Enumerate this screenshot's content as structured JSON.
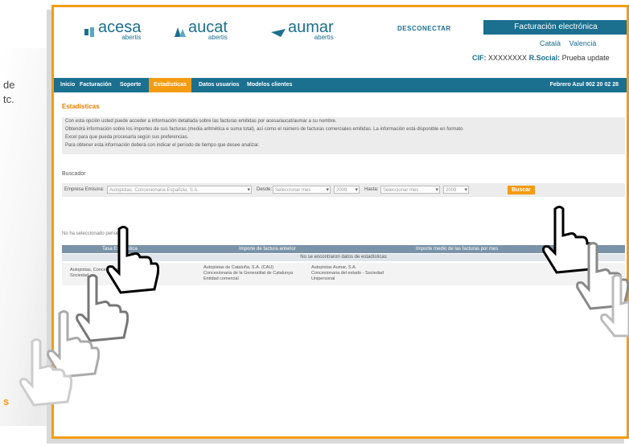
{
  "side_text": [
    "de",
    "tc."
  ],
  "side_orange": "s",
  "header": {
    "logos": [
      {
        "name": "acesa",
        "sub": "abertis"
      },
      {
        "name": "aucat",
        "sub": "abertis"
      },
      {
        "name": "aumar",
        "sub": "abertis"
      }
    ],
    "desconectar": "DESCONECTAR",
    "fe_tab": "Facturación electrónica",
    "languages": [
      "Català",
      "Valencià"
    ],
    "cif_label": "CIF:",
    "cif_value": "XXXXXXXX",
    "rsocial_label": "R.Social:",
    "rsocial_value": "Prueba update"
  },
  "nav": {
    "items": [
      "Inicio",
      "Facturación",
      "Soporte",
      "Estadísticas",
      "Datos usuarios",
      "Modelos clientes"
    ],
    "active_index": 3,
    "date": "Febrero Azul 902 20 02 28"
  },
  "section_title": "Estadísticas",
  "info_lines": [
    "Con esta opción usted puede acceder a información detallada sobre las facturas emitidas por acesa/aucat/aumar a su nombre.",
    "Obtendrá información sobre los importes de sus facturas (media aritmética e suma total), así como el número de facturas comerciales emitidas. La información está disponible en formato",
    "Excel para que pueda procesarla según sus preferencias.",
    "Para obtener esta información deberá con indicar el período de tiempo que desee analizar."
  ],
  "search": {
    "label": "Buscador",
    "empresa_label": "Empresa Emisora:",
    "empresa_value": "Autopistas, Concesionaria Española, S.A.",
    "desde_label": "Desde:",
    "desde_month": "Seleccionar mes",
    "desde_year": "2009",
    "hasta_label": "Hasta:",
    "hasta_month": "Seleccionar mes",
    "hasta_year": "2009",
    "button": "Buscar"
  },
  "period_note": "No ha seleccionado período.",
  "table": {
    "headers": [
      "Tasa Estadística",
      "Importe de factura anterior",
      "Importe medio de las facturas por mes"
    ],
    "no_data": "No se encontraron datos de estadísticas",
    "row": {
      "c1": [
        "Autopistas, Concesionaria Española, S.A.",
        "Sociedad"
      ],
      "c2": [
        "Autopistas de Cataluña, S.A. (CAU)",
        "Concesionaria de la Generalitat de Catalunya",
        "Entidad comercial"
      ],
      "c3": [
        "Autopistas Aumar, S.A.",
        "Concesionaria del estado - Sociedad",
        "Unipersonal"
      ]
    }
  },
  "colors": {
    "accent": "#1b6f8f",
    "highlight": "#f39c12"
  }
}
